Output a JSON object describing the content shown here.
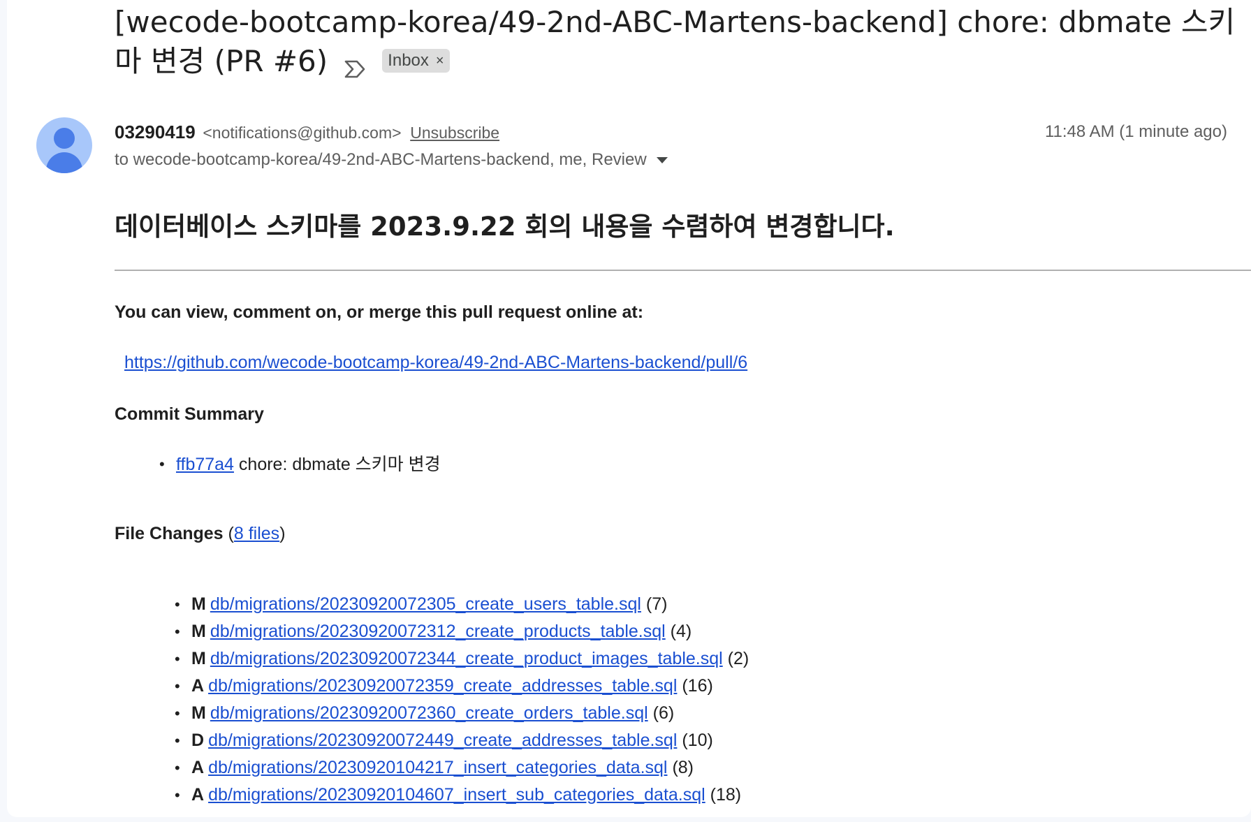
{
  "subject": {
    "text": "[wecode-bootcamp-korea/49-2nd-ABC-Martens-backend] chore: dbmate 스키마 변경 (PR #6)",
    "label": "Inbox",
    "label_close": "×"
  },
  "message": {
    "sender_name": "03290419",
    "sender_email": "<notifications@github.com>",
    "unsubscribe": "Unsubscribe",
    "timestamp": "11:48 AM (1 minute ago)",
    "recipients": "to wecode-bootcamp-korea/49-2nd-ABC-Martens-backend, me, Review"
  },
  "body": {
    "title": "데이터베이스 스키마를 2023.9.22 회의 내용을 수렴하여 변경합니다.",
    "view_text": "You can view, comment on, or merge this pull request online at:",
    "pr_url": "https://github.com/wecode-bootcamp-korea/49-2nd-ABC-Martens-backend/pull/6",
    "commit_heading": "Commit Summary",
    "commits": [
      {
        "sha": "ffb77a4",
        "message": "chore: dbmate 스키마 변경"
      }
    ],
    "files_heading": "File Changes",
    "files_open": " (",
    "files_count_link": "8 files",
    "files_close": ")",
    "files": [
      {
        "status": "M",
        "path": "db/migrations/20230920072305_create_users_table.sql",
        "count": "(7)"
      },
      {
        "status": "M",
        "path": "db/migrations/20230920072312_create_products_table.sql",
        "count": "(4)"
      },
      {
        "status": "M",
        "path": "db/migrations/20230920072344_create_product_images_table.sql",
        "count": "(2)"
      },
      {
        "status": "A",
        "path": "db/migrations/20230920072359_create_addresses_table.sql",
        "count": "(16)"
      },
      {
        "status": "M",
        "path": "db/migrations/20230920072360_create_orders_table.sql",
        "count": "(6)"
      },
      {
        "status": "D",
        "path": "db/migrations/20230920072449_create_addresses_table.sql",
        "count": "(10)"
      },
      {
        "status": "A",
        "path": "db/migrations/20230920104217_insert_categories_data.sql",
        "count": "(8)"
      },
      {
        "status": "A",
        "path": "db/migrations/20230920104607_insert_sub_categories_data.sql",
        "count": "(18)"
      }
    ]
  },
  "colors": {
    "link": "#1a4fd1",
    "avatar_bg": "#a8c7fa",
    "avatar_fg": "#4a7de8"
  },
  "icons": {
    "importance": "importance-marker-icon",
    "avatar": "person-avatar-icon",
    "caret": "caret-down-icon"
  }
}
